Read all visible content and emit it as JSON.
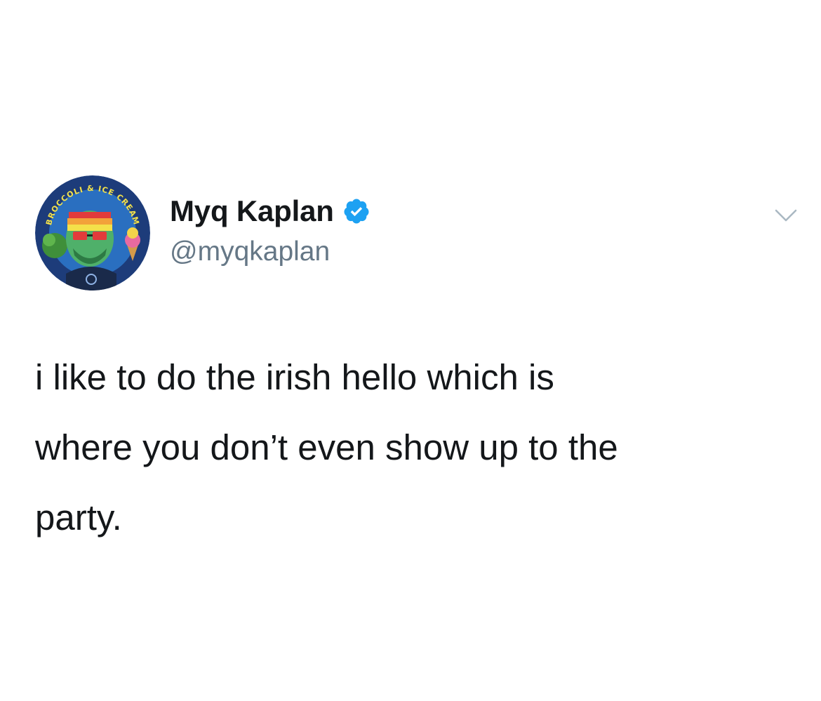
{
  "tweet": {
    "author": {
      "display_name": "Myq Kaplan",
      "handle": "@myqkaplan",
      "verified": true
    },
    "avatar": {
      "badge_text_top": "BROCCOLI & ICE CREAM"
    },
    "text_lines": [
      "i like to do the irish hello which is",
      "where you don’t even show up to the",
      "party."
    ]
  },
  "colors": {
    "name": "#14171a",
    "handle": "#657786",
    "verified_badge": "#1da1f2",
    "caret": "#aab8c2",
    "background": "#ffffff"
  },
  "icons": {
    "verified": "verified-badge-icon",
    "menu": "chevron-down-icon"
  }
}
